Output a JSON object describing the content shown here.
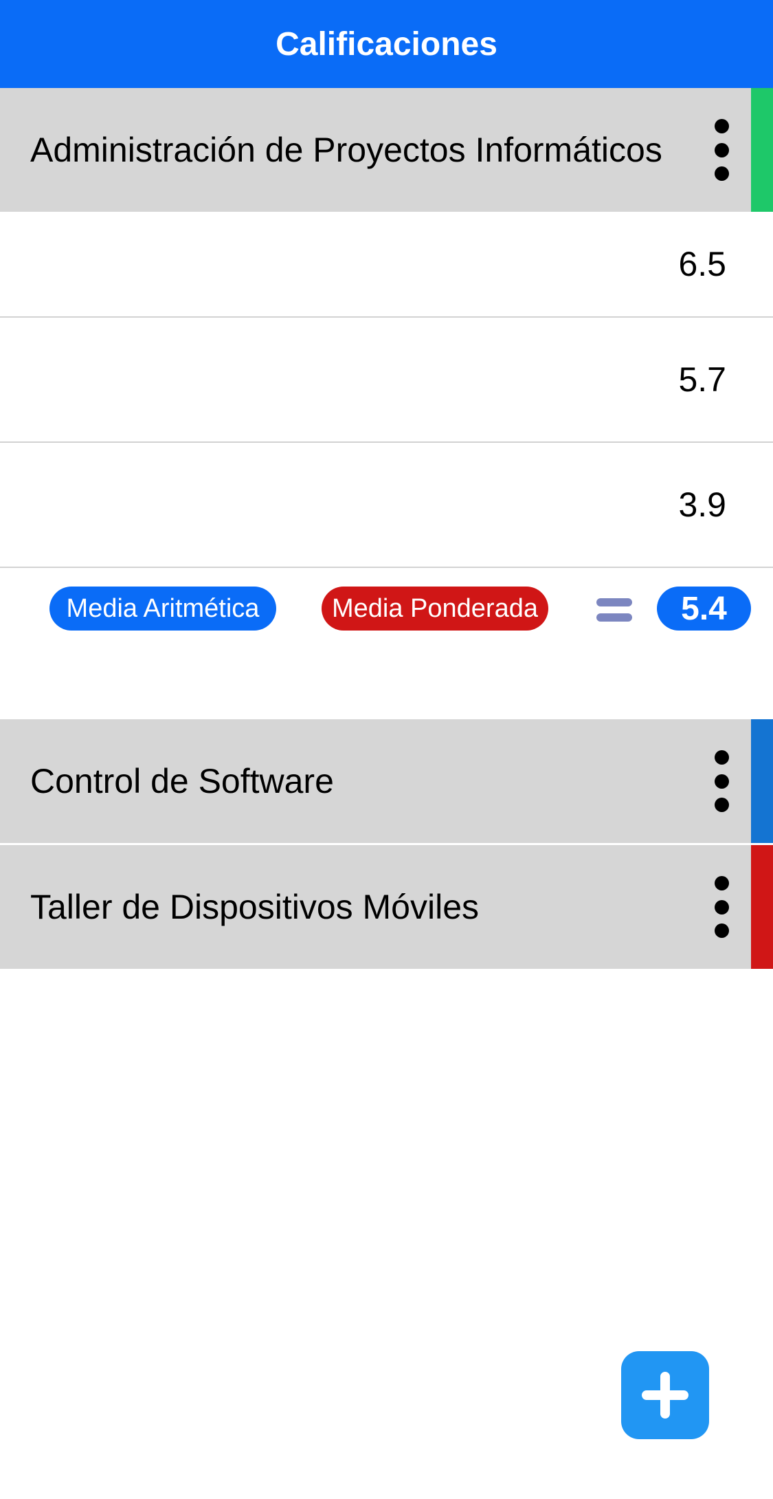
{
  "appbar": {
    "title": "Calificaciones"
  },
  "subjects": [
    {
      "name": "Administración de Proyectos Informáticos",
      "color": "#1ec869",
      "expanded": true
    },
    {
      "name": "Control de Software",
      "color": "#1474d2",
      "expanded": false
    },
    {
      "name": "Taller de Dispositivos Móviles",
      "color": "#d01616",
      "expanded": false
    }
  ],
  "grades": [
    "6.5",
    "5.7",
    "3.9"
  ],
  "averages": {
    "arithmetic_label": "Media Aritmética",
    "weighted_label": "Media Ponderada",
    "result": "5.4"
  },
  "colors": {
    "primary": "#0a6cf7",
    "fab": "#2196f3",
    "card": "#d6d6d6"
  },
  "fab": {
    "icon": "plus-icon"
  }
}
